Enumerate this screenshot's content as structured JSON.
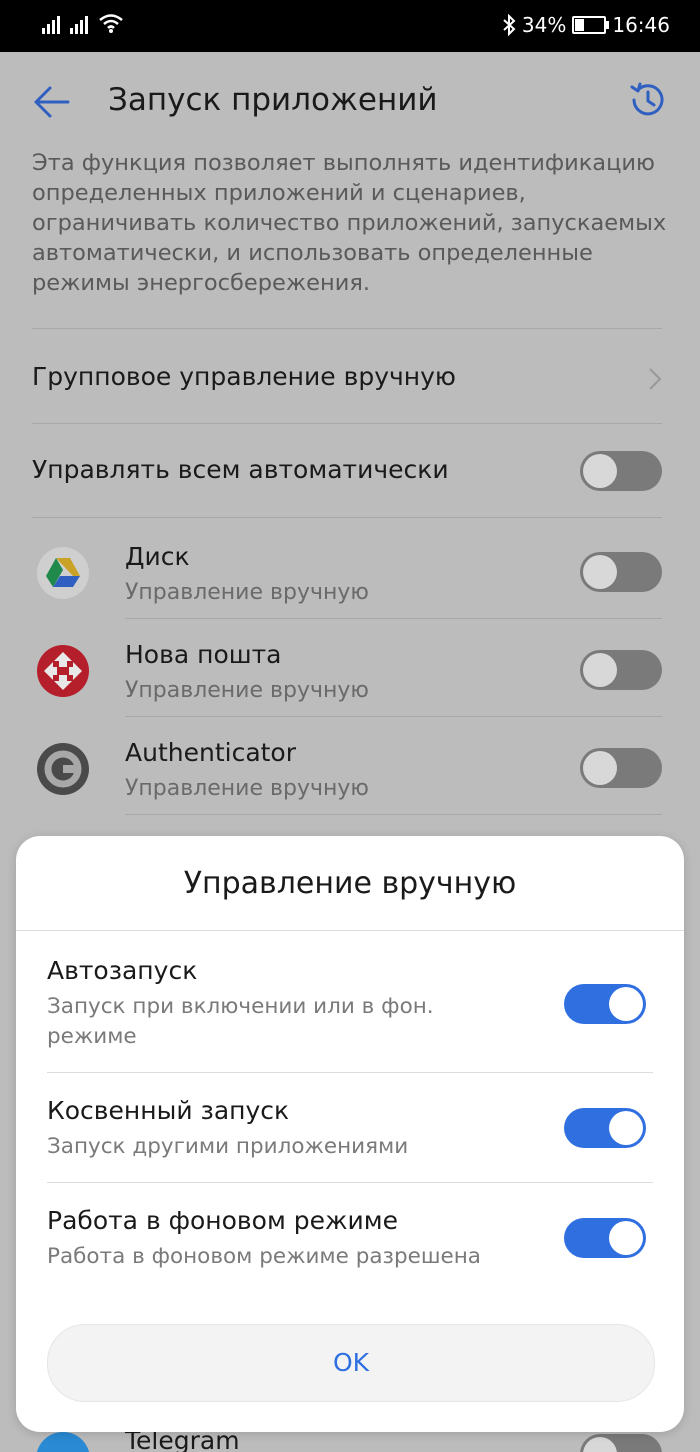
{
  "status_bar": {
    "battery": "34%",
    "battery_level": 0.34,
    "time": "16:46",
    "icons": [
      "signal-icon",
      "signal-icon",
      "wifi-icon",
      "bluetooth-icon",
      "battery-icon"
    ]
  },
  "header": {
    "title": "Запуск приложений",
    "back_icon": "arrow-left-icon",
    "history_icon": "clock-history-icon"
  },
  "description": "Эта функция позволяет выполнять идентификацию определенных приложений и сценариев, ограничивать количество приложений, запускаемых автоматически, и использовать определенные режимы энергосбережения.",
  "group_manage": {
    "label": "Групповое управление вручную"
  },
  "auto_manage": {
    "label": "Управлять всем автоматически",
    "enabled": false
  },
  "apps": [
    {
      "name": "Диск",
      "status": "Управление вручную",
      "icon": "google-drive-icon",
      "enabled": false
    },
    {
      "name": "Нова пошта",
      "status": "Управление вручную",
      "icon": "nova-poshta-icon",
      "enabled": false
    },
    {
      "name": "Authenticator",
      "status": "Управление вручную",
      "icon": "authenticator-icon",
      "enabled": false
    },
    {
      "name": "Telegram",
      "icon": "telegram-icon",
      "enabled": false
    }
  ],
  "dialog": {
    "title": "Управление вручную",
    "options": [
      {
        "title": "Автозапуск",
        "subtitle": "Запуск при включении или в фон. режиме",
        "enabled": true
      },
      {
        "title": "Косвенный запуск",
        "subtitle": "Запуск другими приложениями",
        "enabled": true
      },
      {
        "title": "Работа в фоновом режиме",
        "subtitle": "Работа в фоновом режиме разрешена",
        "enabled": true
      }
    ],
    "ok_label": "OK"
  },
  "colors": {
    "accent": "#2f6fe0",
    "dim_background": "#bcbcbc"
  }
}
